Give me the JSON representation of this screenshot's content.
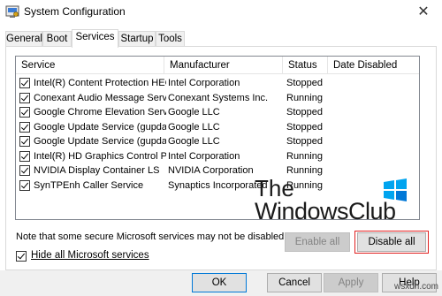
{
  "window": {
    "title": "System Configuration",
    "close_glyph": "✕",
    "icon": "msconfig-icon"
  },
  "tabs": [
    {
      "label": "General",
      "active": false
    },
    {
      "label": "Boot",
      "active": false
    },
    {
      "label": "Services",
      "active": true
    },
    {
      "label": "Startup",
      "active": false
    },
    {
      "label": "Tools",
      "active": false
    }
  ],
  "services": {
    "columns": [
      "Service",
      "Manufacturer",
      "Status",
      "Date Disabled"
    ],
    "rows": [
      {
        "service": "Intel(R) Content Protection HEC...",
        "manufacturer": "Intel Corporation",
        "status": "Stopped",
        "date_disabled": "",
        "checked": true
      },
      {
        "service": "Conexant Audio Message Service",
        "manufacturer": "Conexant Systems Inc.",
        "status": "Running",
        "date_disabled": "",
        "checked": true
      },
      {
        "service": "Google Chrome Elevation Servic...",
        "manufacturer": "Google LLC",
        "status": "Stopped",
        "date_disabled": "",
        "checked": true
      },
      {
        "service": "Google Update Service (gupdate)",
        "manufacturer": "Google LLC",
        "status": "Stopped",
        "date_disabled": "",
        "checked": true
      },
      {
        "service": "Google Update Service (gupdatem)",
        "manufacturer": "Google LLC",
        "status": "Stopped",
        "date_disabled": "",
        "checked": true
      },
      {
        "service": "Intel(R) HD Graphics Control Pa...",
        "manufacturer": "Intel Corporation",
        "status": "Running",
        "date_disabled": "",
        "checked": true
      },
      {
        "service": "NVIDIA Display Container LS",
        "manufacturer": "NVIDIA Corporation",
        "status": "Running",
        "date_disabled": "",
        "checked": true
      },
      {
        "service": "SynTPEnh Caller Service",
        "manufacturer": "Synaptics Incorporated",
        "status": "Running",
        "date_disabled": "",
        "checked": true
      }
    ]
  },
  "watermark": {
    "line1": "The",
    "line2": "WindowsClub",
    "logo_colors": [
      "#00a4ef",
      "#0078d7"
    ]
  },
  "note": "Note that some secure Microsoft services may not be disabled.",
  "buttons": {
    "enable_all": "Enable all",
    "disable_all": "Disable all",
    "ok": "OK",
    "cancel": "Cancel",
    "apply": "Apply",
    "help": "Help"
  },
  "hide_ms": {
    "label": "Hide all Microsoft services",
    "checked": true
  },
  "source_mark": "wsxdn.com",
  "colors": {
    "highlight_outline": "#e02020",
    "focus_border": "#0078d7"
  }
}
